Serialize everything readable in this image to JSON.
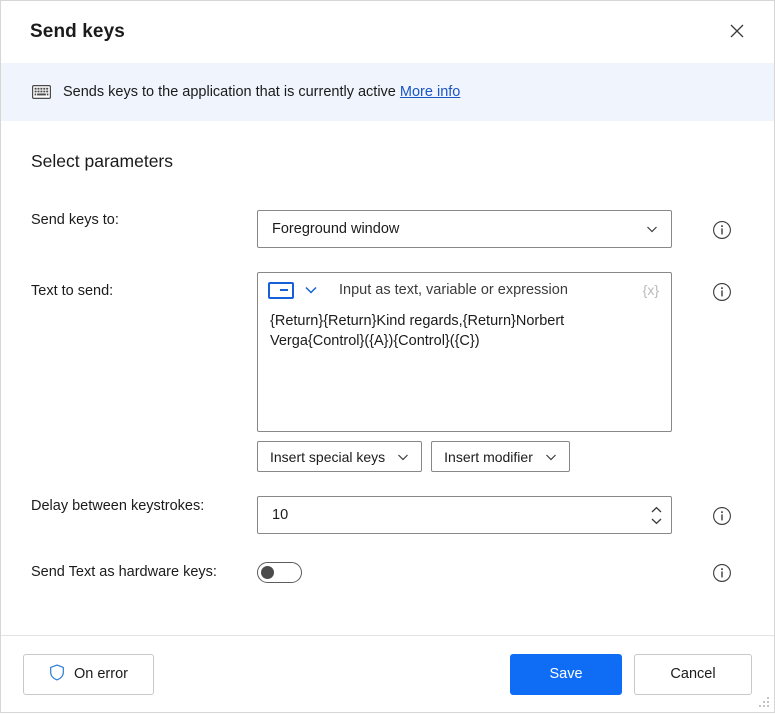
{
  "window": {
    "title": "Send keys",
    "close_icon": "close-icon",
    "resize_grip": "resize-grip"
  },
  "banner": {
    "icon": "keyboard-icon",
    "text": "Sends keys to the application that is currently active ",
    "link_label": "More info",
    "background": "#eff4fd",
    "link_color": "#1a56c4"
  },
  "section": {
    "title": "Select parameters"
  },
  "fields": {
    "send_keys_to": {
      "label": "Send keys to:",
      "value": "Foreground window",
      "info_icon": "info-icon"
    },
    "text_to_send": {
      "label": "Text to send:",
      "mode_icon": "text-input-mode-icon",
      "mode_chevron_icon": "chevron-down-icon",
      "placeholder": "Input as text, variable or expression",
      "variable_button": "{x}",
      "value": "{Return}{Return}Kind regards,{Return}Norbert Verga{Control}({A}){Control}({C})",
      "info_icon": "info-icon",
      "buttons": [
        {
          "label": "Insert special keys",
          "name": "insert-special-keys-button"
        },
        {
          "label": "Insert modifier",
          "name": "insert-modifier-button"
        }
      ]
    },
    "delay": {
      "label": "Delay between keystrokes:",
      "value": "10",
      "info_icon": "info-icon"
    },
    "hardware_keys": {
      "label": "Send Text as hardware keys:",
      "state": "off",
      "info_icon": "info-icon"
    }
  },
  "footer": {
    "on_error_label": "On error",
    "on_error_icon": "shield-icon",
    "save_label": "Save",
    "cancel_label": "Cancel",
    "save_color": "#0f6cf5"
  }
}
